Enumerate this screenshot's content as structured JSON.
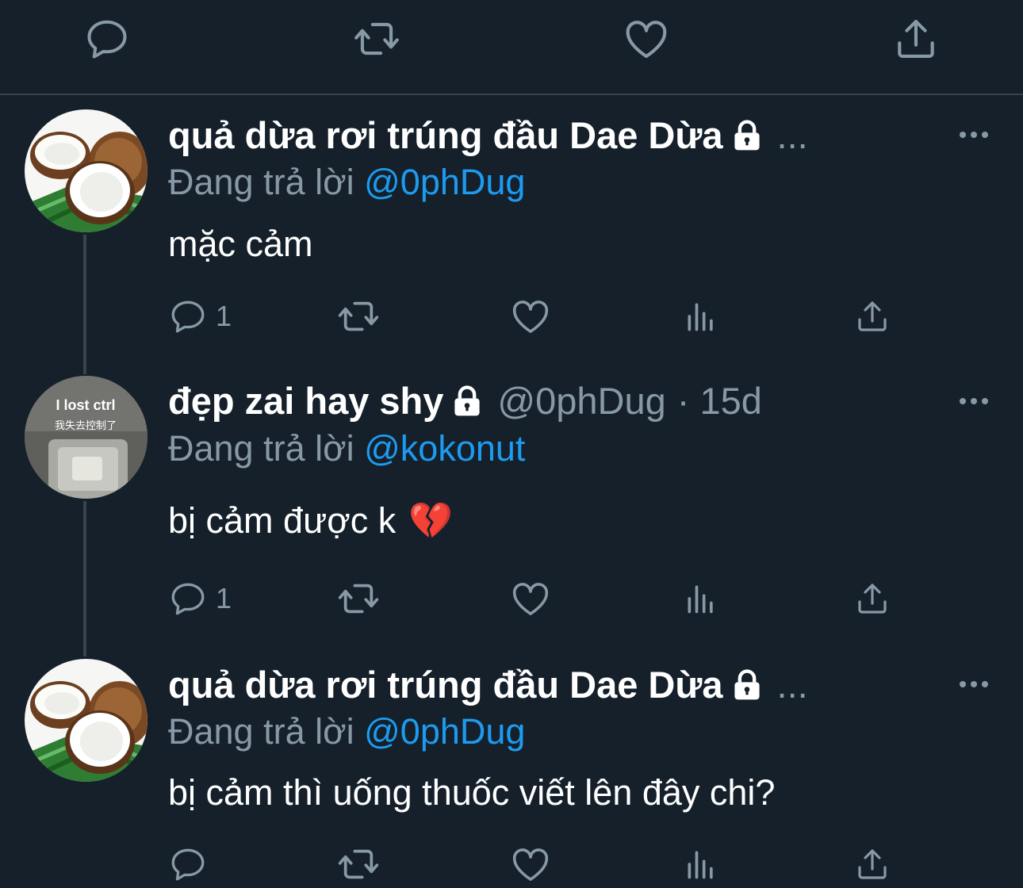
{
  "top_actions": {
    "reply_icon": "reply-icon",
    "retweet_icon": "retweet-icon",
    "like_icon": "like-icon",
    "share_icon": "share-icon"
  },
  "tweets": [
    {
      "display_name": "quả dừa rơi trúng đầu Dae Dừa",
      "protected": true,
      "overflow": "...",
      "handle": "",
      "timestamp": "",
      "reply_prefix": "Đang trả lời ",
      "reply_to": "@0phDug",
      "text": "mặc cảm",
      "emoji": "",
      "reply_count": "1",
      "avatar": "coconut-avatar"
    },
    {
      "display_name": "đẹp zai hay shy",
      "protected": true,
      "overflow": "",
      "handle": "@0phDug",
      "timestamp": "· 15d",
      "reply_prefix": "Đang trả lời ",
      "reply_to": "@kokonut",
      "text": "bị cảm được k",
      "emoji": "💔",
      "reply_count": "1",
      "avatar": "keyboard-avatar",
      "avatar_text_1": "I lost ctrl",
      "avatar_text_2": "我失去控制了"
    },
    {
      "display_name": "quả dừa rơi trúng đầu Dae Dừa",
      "protected": true,
      "overflow": "...",
      "handle": "",
      "timestamp": "",
      "reply_prefix": "Đang trả lời ",
      "reply_to": "@0phDug",
      "text": "bị cảm thì uống thuốc viết lên đây chi?",
      "emoji": "",
      "reply_count": "",
      "avatar": "coconut-avatar"
    }
  ],
  "colors": {
    "background": "#15202b",
    "muted": "#8899a6",
    "link": "#1d9bf0",
    "divider": "#38444d"
  }
}
